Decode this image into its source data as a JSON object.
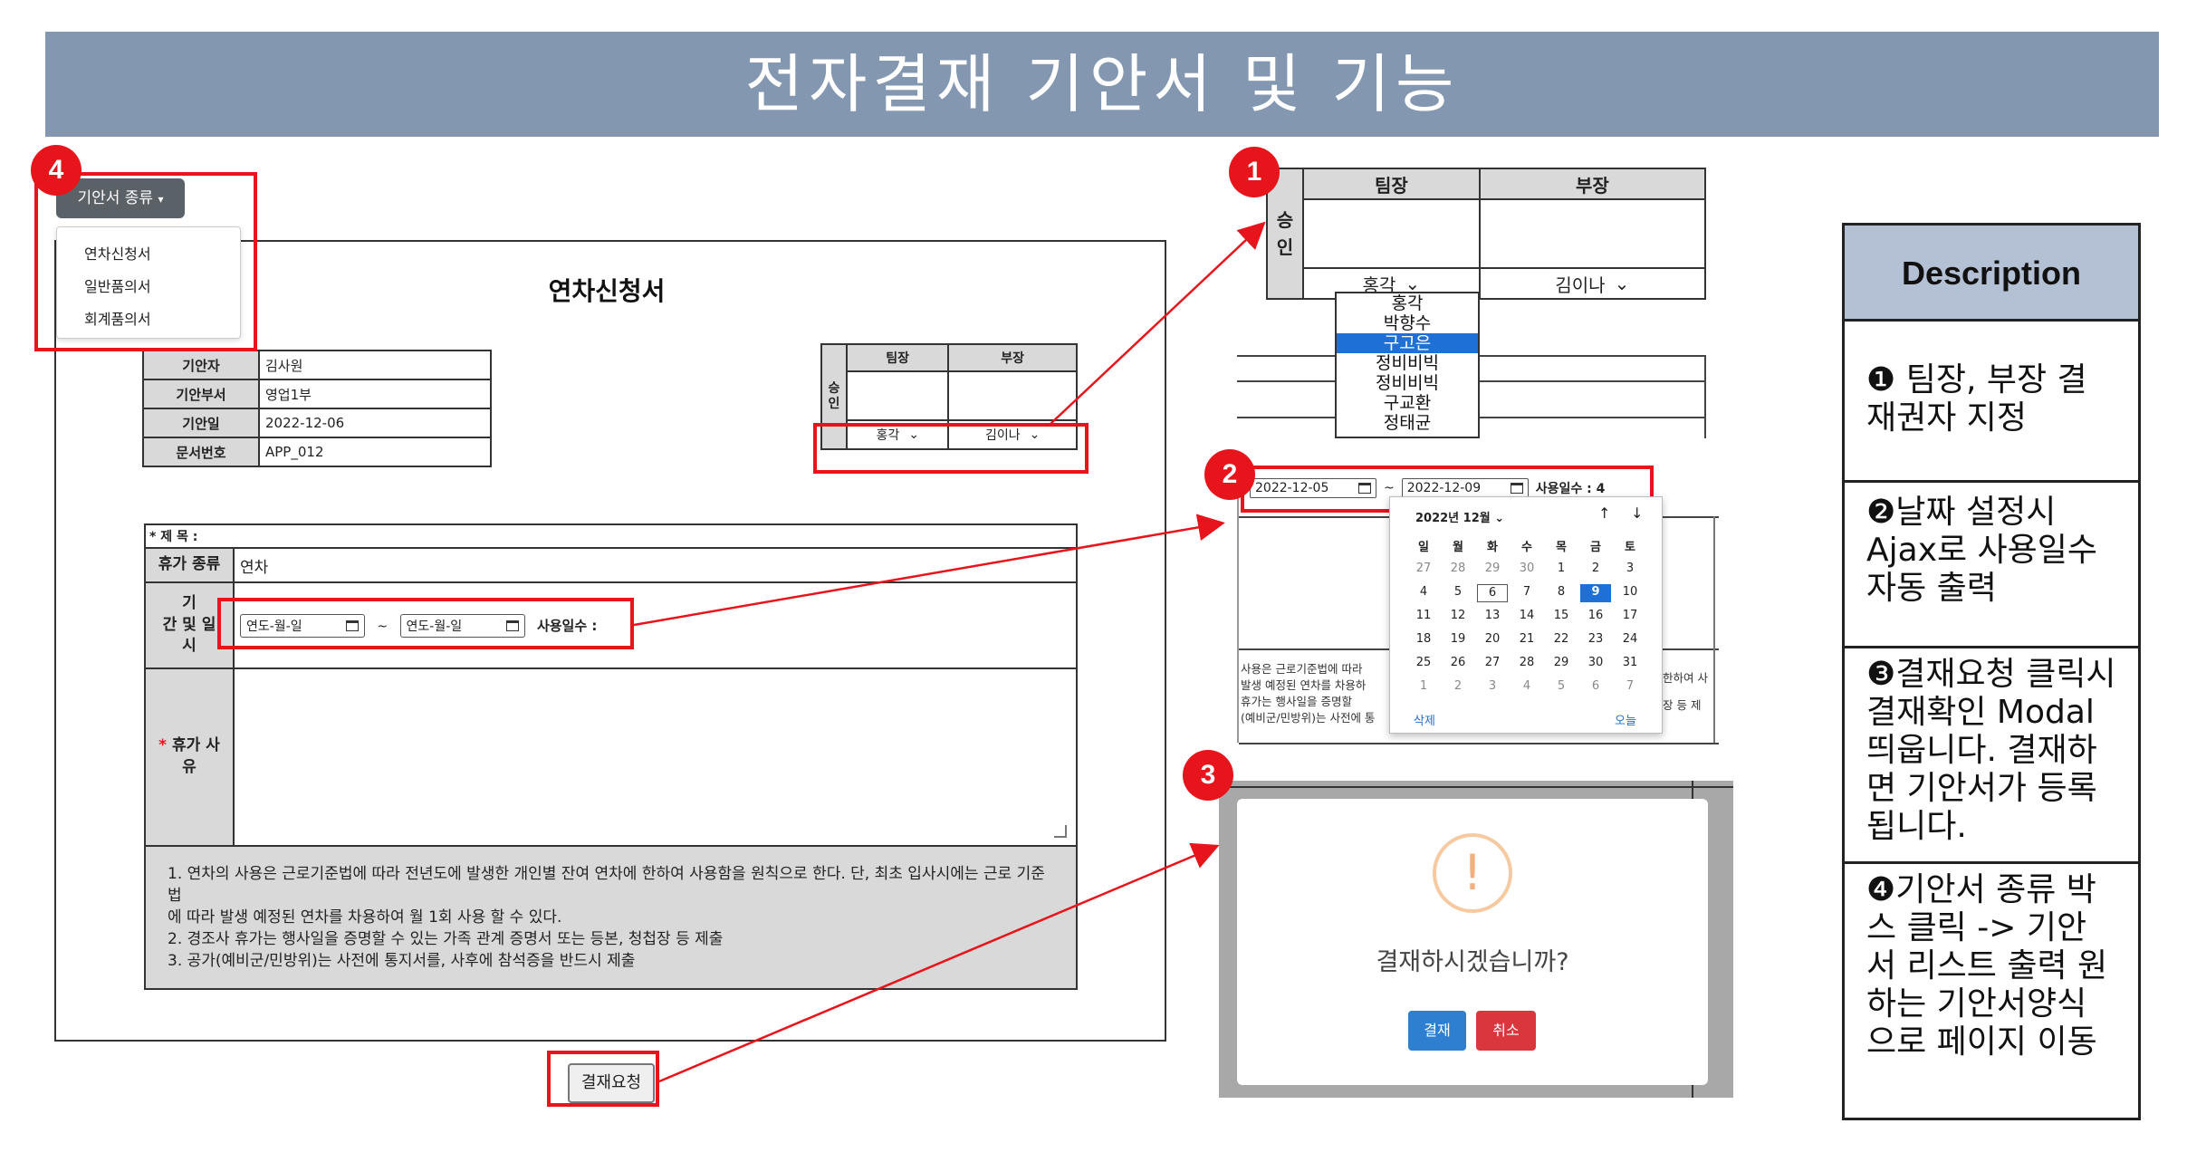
{
  "banner": {
    "title": "전자결재 기안서 및 기능"
  },
  "badges": {
    "one": "1",
    "two": "2",
    "three": "3",
    "four": "4"
  },
  "dropdown": {
    "button_label": "기안서 종류",
    "items": [
      "연차신청서",
      "일반품의서",
      "회계품의서"
    ]
  },
  "form": {
    "title": "연차신청서",
    "info_rows": [
      {
        "label": "기안자",
        "value": "김사원"
      },
      {
        "label": "기안부서",
        "value": "영업1부"
      },
      {
        "label": "기안일",
        "value": "2022-12-06"
      },
      {
        "label": "문서번호",
        "value": "APP_012"
      }
    ],
    "approval": {
      "side_label_1": "승",
      "side_label_2": "인",
      "col1": "팀장",
      "col2": "부장",
      "sel1": "홍각",
      "sel2": "김이나"
    },
    "subject_label": "* 제 목 :",
    "leave_type_label": "휴가 종류",
    "leave_type_value": "연차",
    "period_label_1": "기",
    "period_label_2": "간 및 일",
    "period_label_3": "시",
    "date_placeholder": "연도-월-일",
    "date_sep": "~",
    "days_label": "사용일수 :",
    "reason_star": "*",
    "reason_label_1": "휴가 사",
    "reason_label_2": "유",
    "notes": [
      "1. 연차의 사용은 근로기준법에 따라 전년도에 발생한 개인별 잔여 연차에 한하여 사용함을 원칙으로 한다. 단, 최초 입사시에는 근로 기준법",
      "에 따라 발생 예정된 연차를 차용하여 월 1회 사용 할 수 있다.",
      "2. 경조사 휴가는 행사일을 증명할 수 있는 가족 관계 증명서 또는 등본, 청첩장 등 제출",
      "3. 공가(예비군/민방위)는 사전에 통지서를, 사후에 참석증을 반드시 제출"
    ],
    "submit_label": "결재요청"
  },
  "zoom_approval": {
    "col1": "팀장",
    "col2": "부장",
    "side_1": "승",
    "side_2": "인",
    "sel1": "홍각",
    "sel2": "김이나",
    "options": [
      "홍각",
      "박향수",
      "구고은",
      "정비비빅",
      "정비비빅",
      "구교환",
      "정태균"
    ],
    "selected_index": 2
  },
  "zoom_date": {
    "start": "2022-12-05",
    "sep": "~",
    "end": "2022-12-09",
    "days_text": "사용일수 : 4",
    "calendar": {
      "month_label": "2022년 12월",
      "weekdays": [
        "일",
        "월",
        "화",
        "수",
        "목",
        "금",
        "토"
      ],
      "weeks": [
        [
          "27",
          "28",
          "29",
          "30",
          "1",
          "2",
          "3"
        ],
        [
          "4",
          "5",
          "6",
          "7",
          "8",
          "9",
          "10"
        ],
        [
          "11",
          "12",
          "13",
          "14",
          "15",
          "16",
          "17"
        ],
        [
          "18",
          "19",
          "20",
          "21",
          "22",
          "23",
          "24"
        ],
        [
          "25",
          "26",
          "27",
          "28",
          "29",
          "30",
          "31"
        ],
        [
          "1",
          "2",
          "3",
          "4",
          "5",
          "6",
          "7"
        ]
      ],
      "today": "6",
      "picked": "9",
      "clear_label": "삭제",
      "today_label": "오늘"
    },
    "bg_text_1": "사용은 근로기준법에 따라",
    "bg_text_2": "발생 예정된 연차를 차용하",
    "bg_text_3": "휴가는 행사일을 증명할",
    "bg_text_4": "(예비군/민방위)는 사전에 통",
    "bg_text_r1": "한하여 사",
    "bg_text_r2": "장 등 제"
  },
  "modal": {
    "icon": "!",
    "question": "결재하시겠습니까?",
    "confirm": "결재",
    "cancel": "취소",
    "colors": {
      "confirm": "#2f7fd1",
      "cancel": "#d9363e"
    }
  },
  "description": {
    "header": "Description",
    "items": [
      "❶ 팀장, 부장 결재권자 지정",
      "❷날짜 설정시 Ajax로 사용일수 자동 출력",
      "❸결재요청 클릭시 결재확인 Modal 띄웁니다. 결재하면 기안서가 등록됩니다.",
      "❹기안서 종류 박스 클릭 -> 기안서 리스트 출력 원하는 기안서양식으로 페이지 이동"
    ]
  },
  "colors": {
    "banner": "#8497b0",
    "highlight": "#e8141b",
    "desc_header": "#b4c0d3",
    "label_bg": "#d9d9d9"
  }
}
